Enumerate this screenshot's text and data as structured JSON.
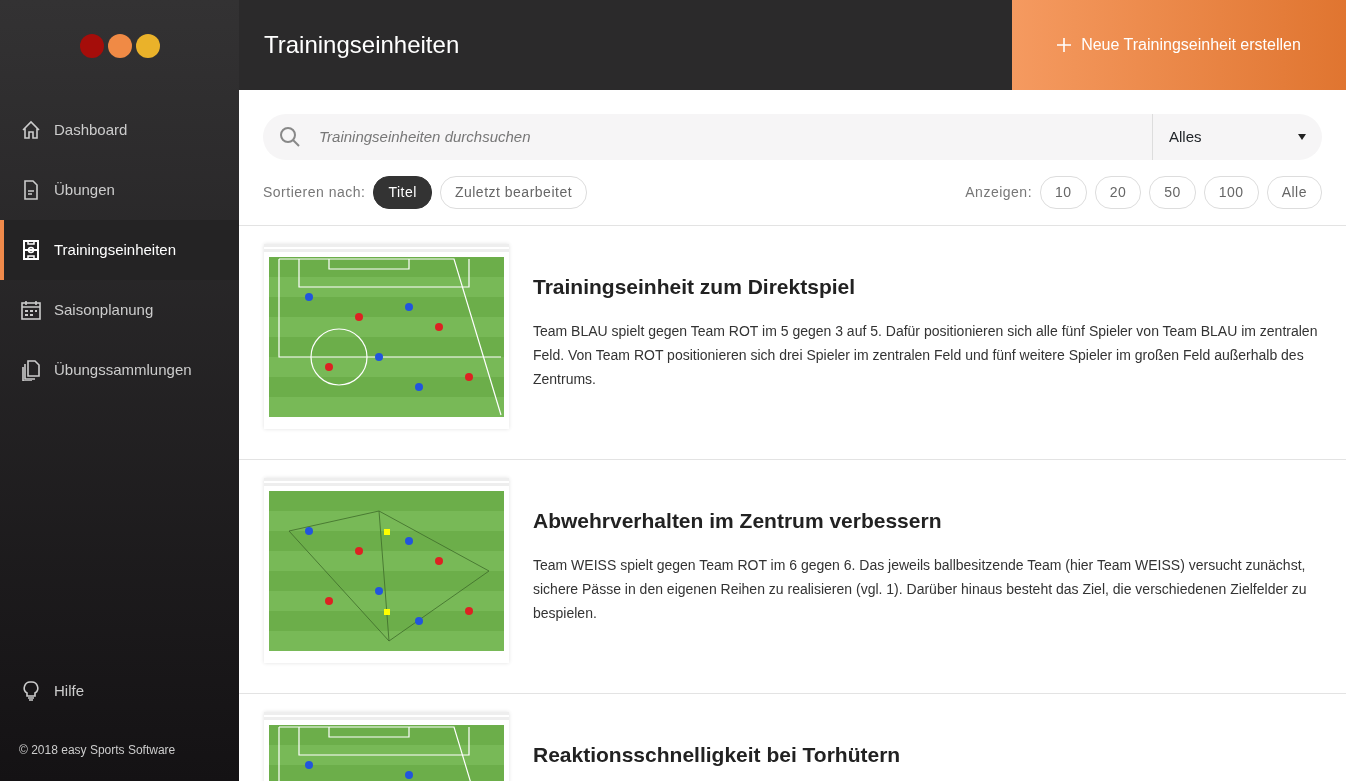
{
  "sidebar": {
    "items": [
      {
        "label": "Dashboard",
        "selected": false
      },
      {
        "label": "Übungen",
        "selected": false
      },
      {
        "label": "Trainingseinheiten",
        "selected": true
      },
      {
        "label": "Saisonplanung",
        "selected": false
      },
      {
        "label": "Übungssammlungen",
        "selected": false
      }
    ],
    "help": "Hilfe",
    "copyright": "© 2018 easy Sports Software"
  },
  "header": {
    "title": "Trainingseinheiten",
    "action": "Neue Trainingseinheit erstellen"
  },
  "search": {
    "placeholder": "Trainingseinheiten durchsuchen",
    "filter": "Alles"
  },
  "sort": {
    "label": "Sortieren nach:",
    "options": [
      {
        "label": "Titel",
        "selected": true
      },
      {
        "label": "Zuletzt bearbeitet",
        "selected": false
      }
    ]
  },
  "page_size": {
    "label": "Anzeigen:",
    "options": [
      {
        "label": "10",
        "selected": false
      },
      {
        "label": "20",
        "selected": false
      },
      {
        "label": "50",
        "selected": false
      },
      {
        "label": "100",
        "selected": false
      },
      {
        "label": "Alle",
        "selected": false
      }
    ]
  },
  "sessions": [
    {
      "title": "Trainingseinheit zum Direktspiel",
      "description": "Team BLAU spielt gegen Team ROT im 5 gegen 3 auf 5. Dafür positionieren sich alle fünf Spieler von Team BLAU im zentralen Feld. Von Team ROT positionieren sich drei Spieler im zentralen Feld und fünf weitere Spieler im großen Feld außerhalb des Zentrums."
    },
    {
      "title": "Abwehrverhalten im Zentrum verbessern",
      "description": "Team WEISS spielt gegen Team ROT im 6 gegen 6. Das jeweils ballbesitzende Team (hier Team WEISS) versucht zunächst, sichere Pässe in den eigenen Reihen zu realisieren (vgl. 1). Darüber hinaus besteht das Ziel, die verschiedenen Zielfelder zu bespielen."
    },
    {
      "title": "Reaktionsschnelligkeit bei Torhütern"
    }
  ]
}
